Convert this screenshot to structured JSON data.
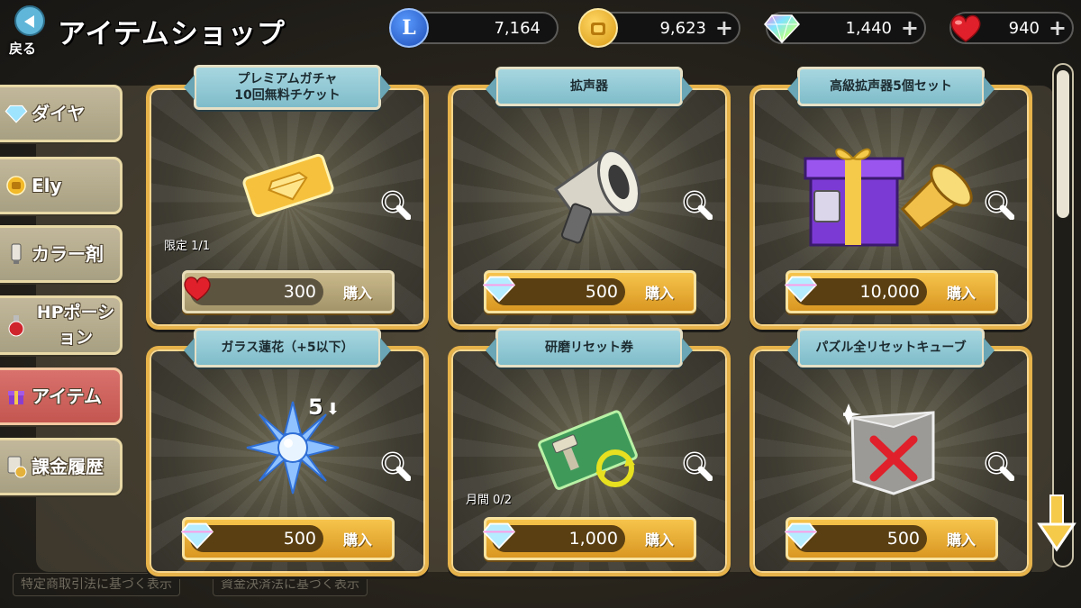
{
  "header": {
    "back_label": "戻る",
    "title": "アイテムショップ",
    "currencies": [
      {
        "icon": "ely-point-icon",
        "value": "7,164",
        "has_plus": false
      },
      {
        "icon": "ely-coin-icon",
        "value": "9,623",
        "has_plus": true
      },
      {
        "icon": "diamond-icon",
        "value": "1,440",
        "has_plus": true
      },
      {
        "icon": "heart-icon",
        "value": "940",
        "has_plus": true
      }
    ]
  },
  "sidebar": {
    "items": [
      {
        "label": "ダイヤ",
        "icon": "diamond-icon",
        "active": false
      },
      {
        "label": "Ely",
        "icon": "ely-coin-icon",
        "active": false
      },
      {
        "label": "カラー剤",
        "icon": "color-tube-icon",
        "active": false
      },
      {
        "label": "HPポーション",
        "icon": "potion-icon",
        "active": false
      },
      {
        "label": "アイテム",
        "icon": "gift-box-icon",
        "active": true
      },
      {
        "label": "課金履歴",
        "icon": "receipt-icon",
        "active": false
      }
    ]
  },
  "items": [
    {
      "title": "プレミアムガチャ\n10回無料チケット",
      "image": "gold-ticket-icon",
      "limit": "限定 1/1",
      "price": "300",
      "currency": "heart-icon",
      "buy_label": "購入"
    },
    {
      "title": "拡声器",
      "image": "megaphone-icon",
      "limit": "",
      "price": "500",
      "currency": "diamond-icon",
      "buy_label": "購入"
    },
    {
      "title": "高級拡声器5個セット",
      "image": "gift-megaphone-icon",
      "limit": "",
      "price": "10,000",
      "currency": "diamond-icon",
      "buy_label": "購入"
    },
    {
      "title": "ガラス蓮花（+5以下）",
      "image": "crystal-lotus-icon",
      "limit": "",
      "badge": "5",
      "price": "500",
      "currency": "diamond-icon",
      "buy_label": "購入"
    },
    {
      "title": "研磨リセット券",
      "image": "reset-ticket-icon",
      "limit": "月間 0/2",
      "price": "1,000",
      "currency": "diamond-icon",
      "buy_label": "購入"
    },
    {
      "title": "パズル全リセットキューブ",
      "image": "reset-cube-icon",
      "limit": "",
      "price": "500",
      "currency": "diamond-icon",
      "buy_label": "購入"
    }
  ],
  "footer": {
    "left": "特定商取引法に基づく表示",
    "right": "資金決済法に基づく表示"
  },
  "colors": {
    "card_border": "#e6b24a",
    "ribbon": "#a7d7e0",
    "buy_button": "#f6c44c",
    "active_tab": "#d9716c"
  }
}
